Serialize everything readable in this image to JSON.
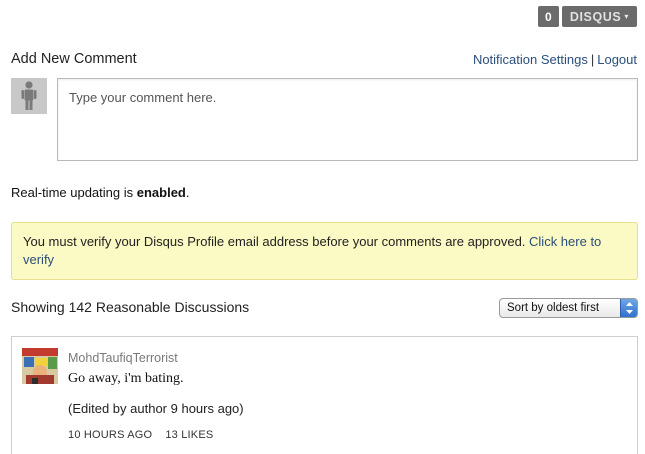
{
  "topbar": {
    "comment_count": "0",
    "brand": "DISQUS",
    "caret": "▾"
  },
  "add_comment": {
    "title": "Add New Comment",
    "notification_link": "Notification Settings",
    "separator": "|",
    "logout_link": "Logout",
    "placeholder": "Type your comment here."
  },
  "realtime": {
    "prefix": "Real-time updating is ",
    "status": "enabled",
    "suffix": "."
  },
  "notice": {
    "text": "You must verify your Disqus Profile email address before your comments are approved. ",
    "link": "Click here to verify"
  },
  "discussion": {
    "showing": "Showing 142 Reasonable Discussions",
    "sort_selected": "Sort by oldest first"
  },
  "comments": [
    {
      "author": "MohdTaufiqTerrorist",
      "message": "Go away, i'm bating.",
      "edited": "(Edited by author 9 hours ago)",
      "time": "10 HOURS AGO",
      "likes": "13 LIKES"
    }
  ],
  "colors": {
    "link": "#2a4f7a",
    "notice_bg": "#fbf9c4",
    "badge_bg": "#6b6b6b",
    "sort_arrow": "#2f6fd0"
  }
}
